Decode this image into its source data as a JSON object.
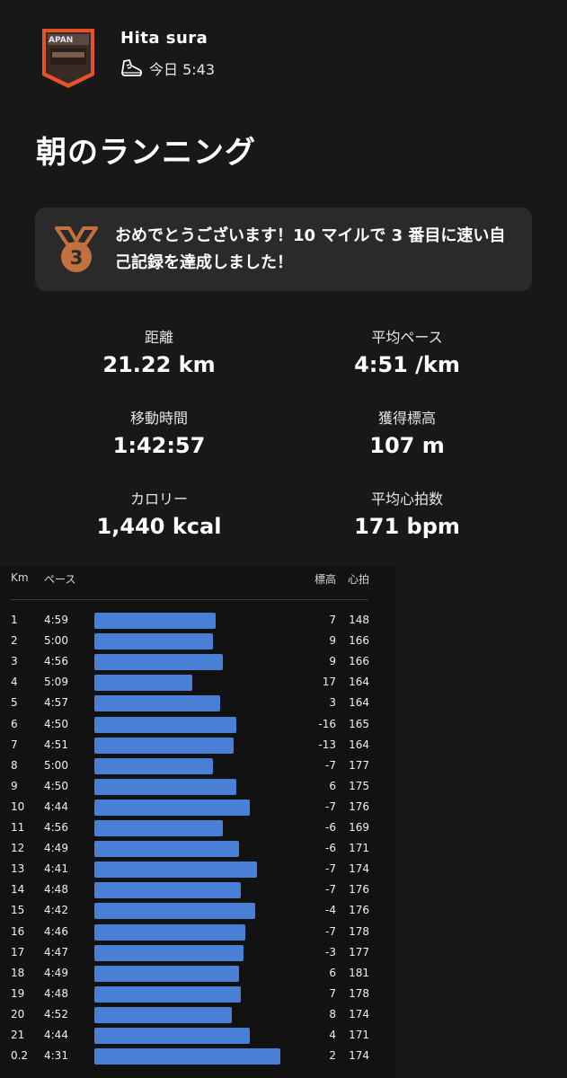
{
  "athlete": {
    "name": "Hita  sura",
    "activity_icon": "running-shoe-icon",
    "timestamp": "今日 5:43",
    "avatar_text": "APAN"
  },
  "activity": {
    "title": "朝のランニング"
  },
  "achievement": {
    "icon": "bronze-medal-icon",
    "rank": "3",
    "text": "おめでとうございます！10 マイルで 3 番目に速い自己記録を達成しました！"
  },
  "stats": [
    {
      "label": "距離",
      "value": "21.22 km"
    },
    {
      "label": "平均ペース",
      "value": "4:51 /km"
    },
    {
      "label": "移動時間",
      "value": "1:42:57"
    },
    {
      "label": "獲得標高",
      "value": "107 m"
    },
    {
      "label": "カロリー",
      "value": "1,440 kcal"
    },
    {
      "label": "平均心拍数",
      "value": "171 bpm"
    }
  ],
  "splits": {
    "headers": {
      "km": "Km",
      "pace": "ペース",
      "elevation": "標高",
      "heart_rate": "心拍"
    },
    "bar_color": "#4a7fd6",
    "rows": [
      {
        "km": "1",
        "pace": "4:59",
        "elev": "7",
        "hr": "148"
      },
      {
        "km": "2",
        "pace": "5:00",
        "elev": "9",
        "hr": "166"
      },
      {
        "km": "3",
        "pace": "4:56",
        "elev": "9",
        "hr": "166"
      },
      {
        "km": "4",
        "pace": "5:09",
        "elev": "17",
        "hr": "164"
      },
      {
        "km": "5",
        "pace": "4:57",
        "elev": "3",
        "hr": "164"
      },
      {
        "km": "6",
        "pace": "4:50",
        "elev": "-16",
        "hr": "165"
      },
      {
        "km": "7",
        "pace": "4:51",
        "elev": "-13",
        "hr": "164"
      },
      {
        "km": "8",
        "pace": "5:00",
        "elev": "-7",
        "hr": "177"
      },
      {
        "km": "9",
        "pace": "4:50",
        "elev": "6",
        "hr": "175"
      },
      {
        "km": "10",
        "pace": "4:44",
        "elev": "-7",
        "hr": "176"
      },
      {
        "km": "11",
        "pace": "4:56",
        "elev": "-6",
        "hr": "169"
      },
      {
        "km": "12",
        "pace": "4:49",
        "elev": "-6",
        "hr": "171"
      },
      {
        "km": "13",
        "pace": "4:41",
        "elev": "-7",
        "hr": "174"
      },
      {
        "km": "14",
        "pace": "4:48",
        "elev": "-7",
        "hr": "176"
      },
      {
        "km": "15",
        "pace": "4:42",
        "elev": "-4",
        "hr": "176"
      },
      {
        "km": "16",
        "pace": "4:46",
        "elev": "-7",
        "hr": "178"
      },
      {
        "km": "17",
        "pace": "4:47",
        "elev": "-3",
        "hr": "177"
      },
      {
        "km": "18",
        "pace": "4:49",
        "elev": "6",
        "hr": "181"
      },
      {
        "km": "19",
        "pace": "4:48",
        "elev": "7",
        "hr": "178"
      },
      {
        "km": "20",
        "pace": "4:52",
        "elev": "8",
        "hr": "174"
      },
      {
        "km": "21",
        "pace": "4:44",
        "elev": "4",
        "hr": "171"
      },
      {
        "km": "0.2",
        "pace": "4:31",
        "elev": "2",
        "hr": "174"
      }
    ]
  }
}
